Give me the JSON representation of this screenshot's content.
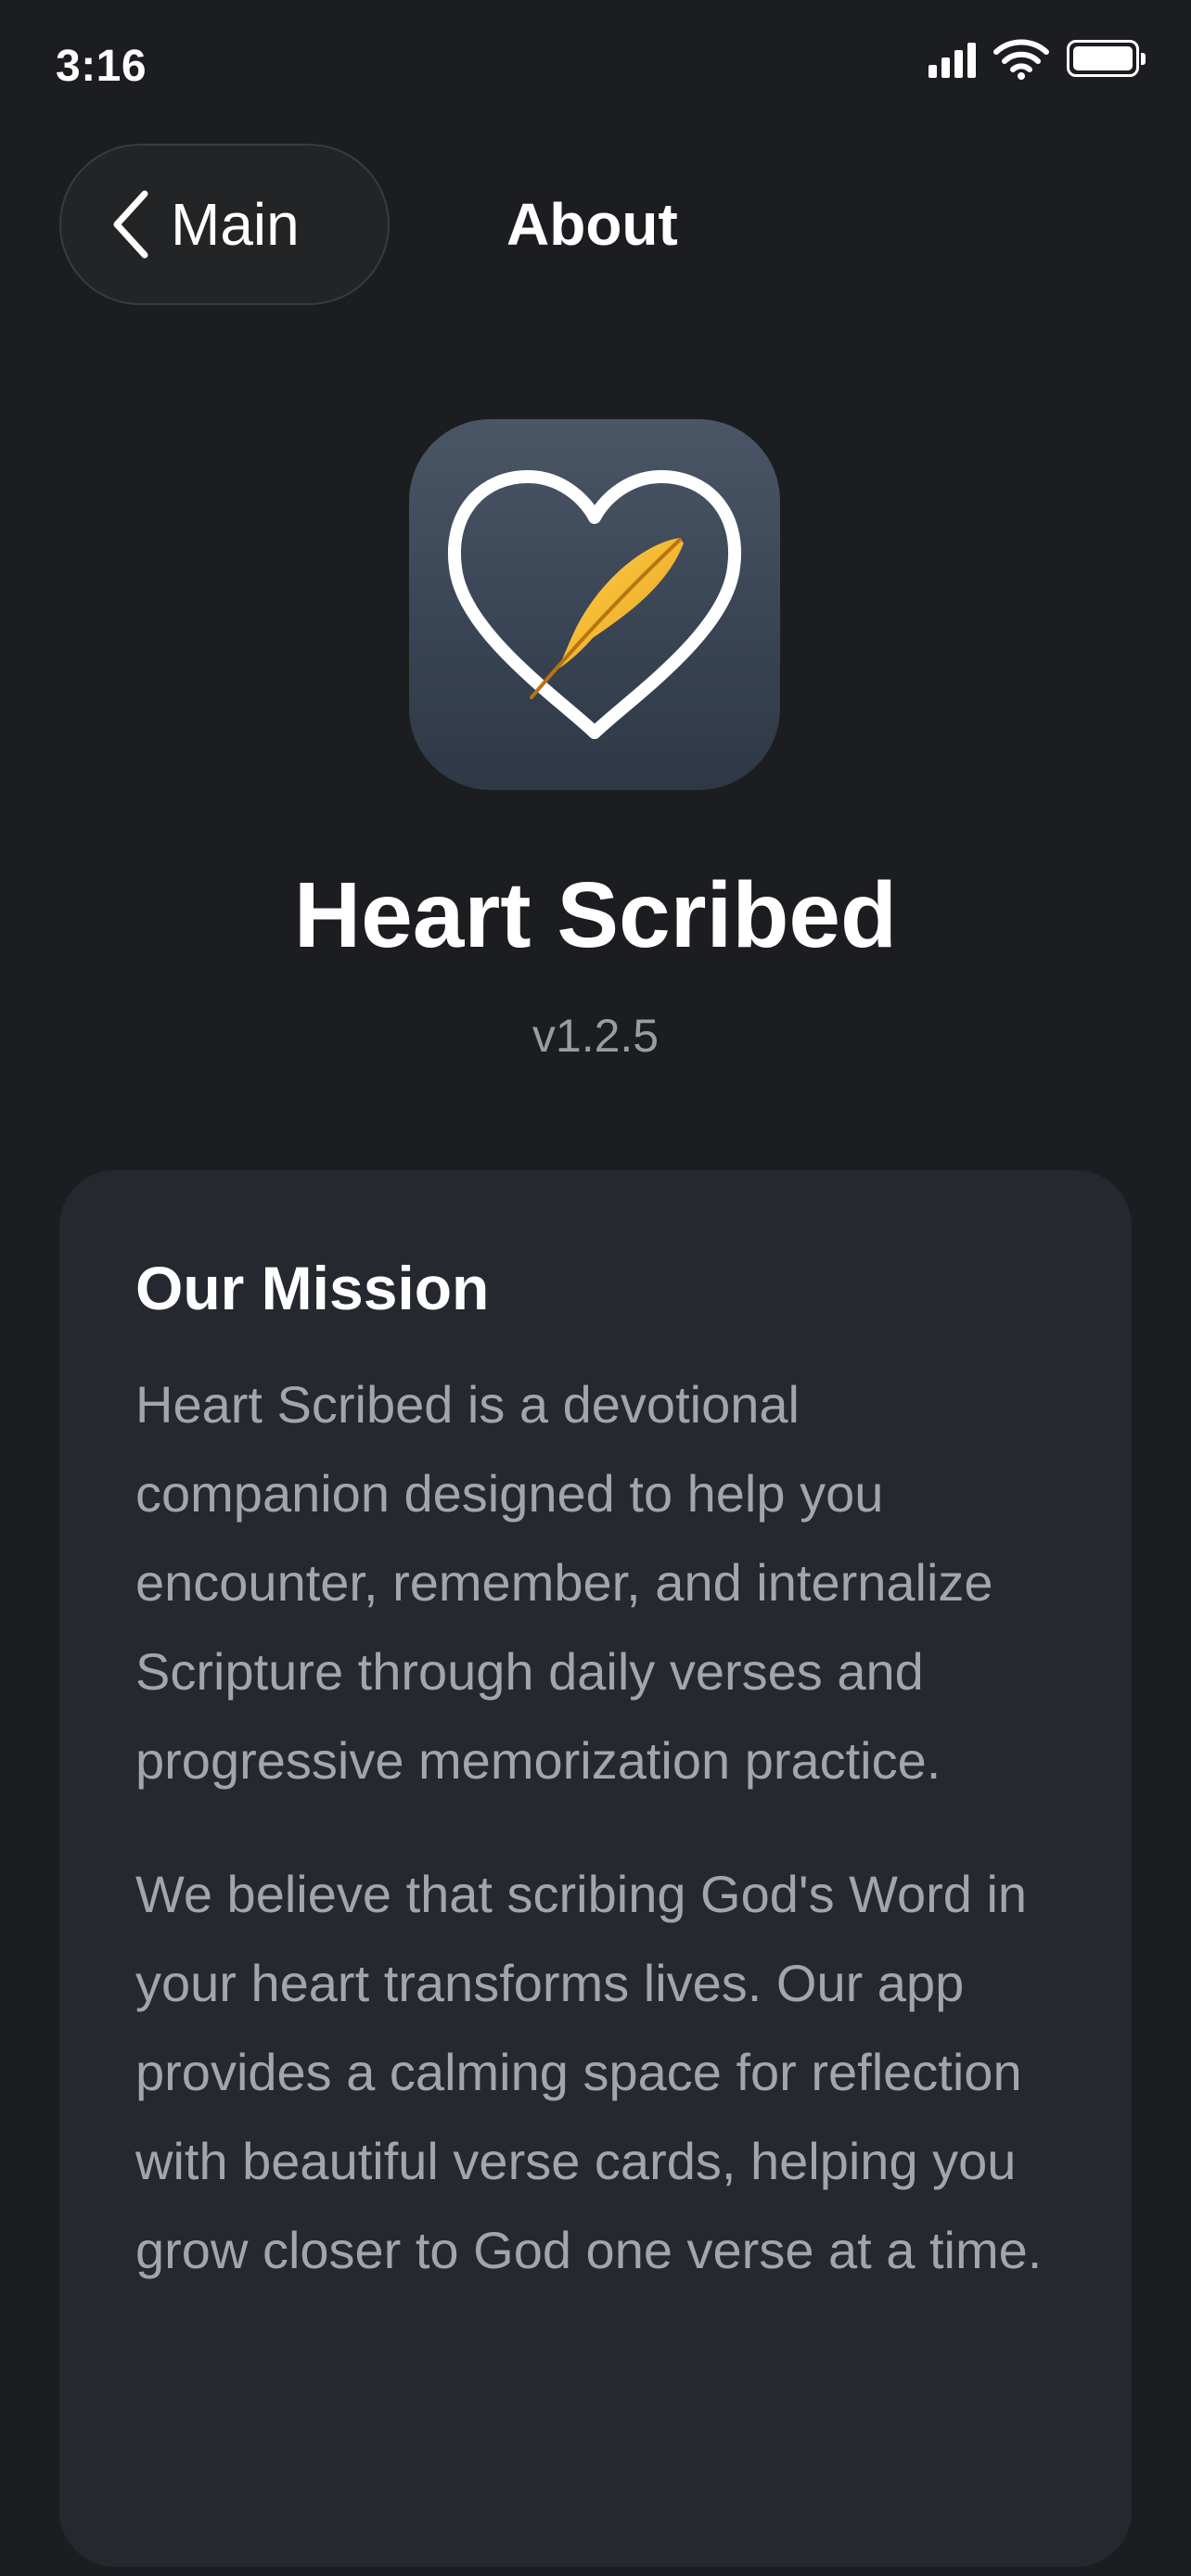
{
  "status_bar": {
    "time": "3:16",
    "icons": [
      "signal-icon",
      "wifi-icon",
      "battery-icon"
    ]
  },
  "nav": {
    "back_label": "Main",
    "back_icon": "chevron-left-icon",
    "title": "About"
  },
  "app": {
    "icon": "heart-feather-logo",
    "name": "Heart Scribed",
    "version": "v1.2.5"
  },
  "mission": {
    "title": "Our Mission",
    "paragraphs": [
      "Heart Scribed is a devotional companion designed to help you encounter, remember, and internalize Scripture through daily verses and progressive memorization practice.",
      "We believe that scribing God's Word in your heart transforms lives. Our app provides a calming space for reflection with beautiful verse cards, helping you grow closer to God one verse at a time."
    ]
  },
  "colors": {
    "background": "#1c1d20",
    "card": "#25282e",
    "text_primary": "#ffffff",
    "text_secondary": "#a3a5aa",
    "feather_gold": "#f2b632"
  }
}
